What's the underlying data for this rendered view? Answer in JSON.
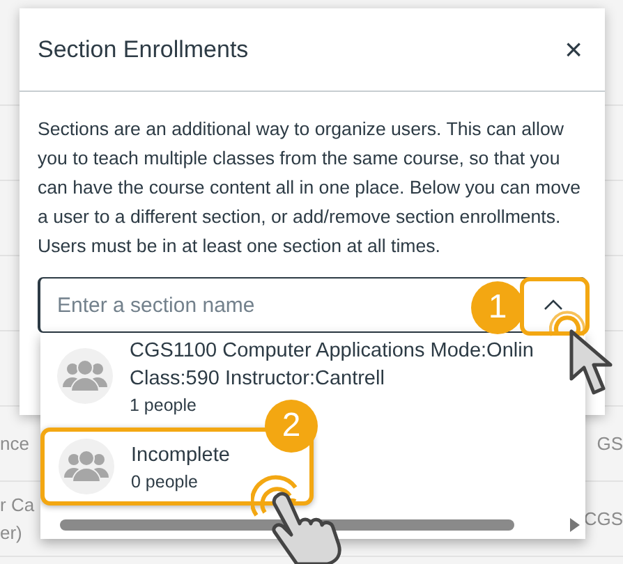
{
  "background": {
    "rows": [
      {
        "left": "",
        "right": ""
      },
      {
        "left": "",
        "right": ""
      },
      {
        "left": "",
        "right": ""
      },
      {
        "left": "",
        "right": ""
      },
      {
        "left": "",
        "right": ""
      },
      {
        "left": "nce",
        "right": "GS"
      },
      {
        "left": "r Ca",
        "left_line2": "er)",
        "right": "CGS"
      }
    ]
  },
  "dialog": {
    "title": "Section Enrollments",
    "close": "×",
    "description": "Sections are an additional way to organize users. This can allow you to teach multiple classes from the same course, so that you can have the course content all in one place. Below you can move a user to a different section, or add/remove section enrollments. Users must be in at least one section at all times.",
    "search": {
      "placeholder": "Enter a section name",
      "expanded": true
    },
    "options": [
      {
        "name_lines": [
          "CGS1100 Computer Applications Mode:Onlin",
          "Class:590 Instructor:Cantrell"
        ],
        "count": "1 people",
        "highlighted": false
      },
      {
        "name_lines": [
          "Incomplete"
        ],
        "count": "0 people",
        "highlighted": true
      }
    ]
  },
  "callouts": [
    {
      "label": "1"
    },
    {
      "label": "2"
    }
  ]
}
